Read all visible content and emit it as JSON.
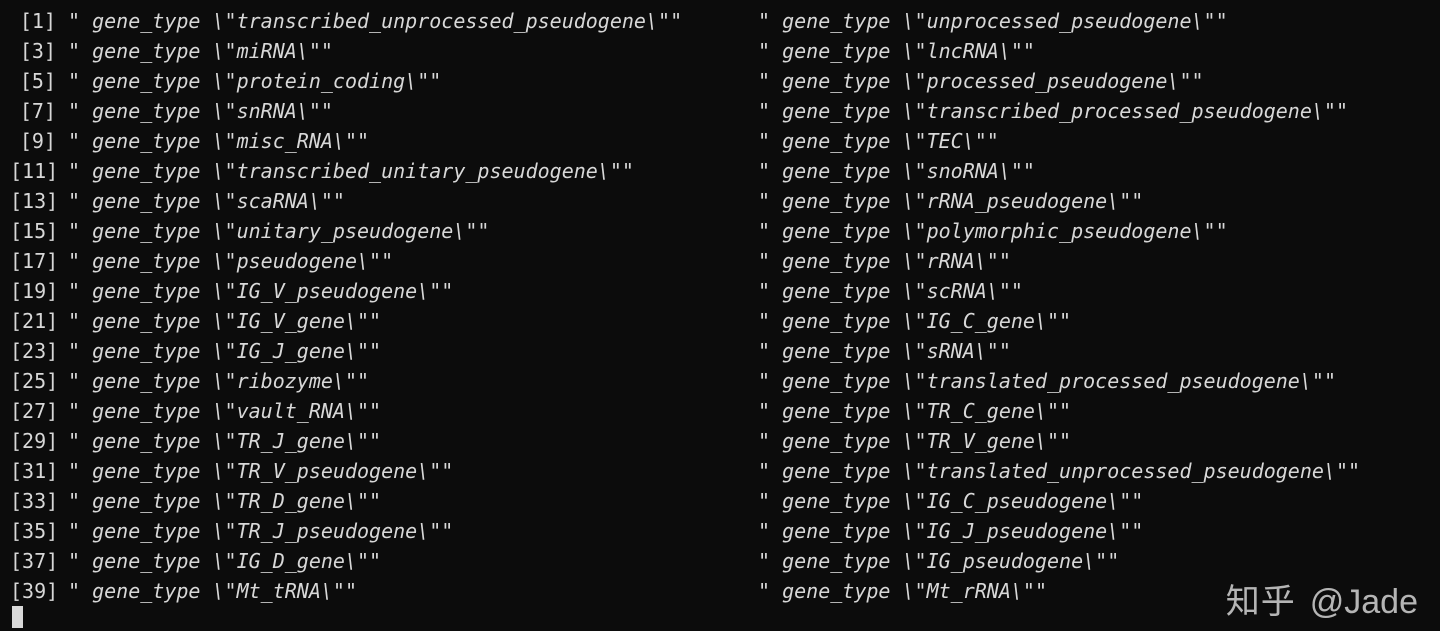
{
  "prefix": "gene_type",
  "watermark": {
    "zh": "知乎",
    "at": "@Jade"
  },
  "rows": [
    {
      "idx": "[1]",
      "left": "transcribed_unprocessed_pseudogene",
      "right": "unprocessed_pseudogene"
    },
    {
      "idx": "[3]",
      "left": "miRNA",
      "right": "lncRNA"
    },
    {
      "idx": "[5]",
      "left": "protein_coding",
      "right": "processed_pseudogene"
    },
    {
      "idx": "[7]",
      "left": "snRNA",
      "right": "transcribed_processed_pseudogene"
    },
    {
      "idx": "[9]",
      "left": "misc_RNA",
      "right": "TEC"
    },
    {
      "idx": "[11]",
      "left": "transcribed_unitary_pseudogene",
      "right": "snoRNA"
    },
    {
      "idx": "[13]",
      "left": "scaRNA",
      "right": "rRNA_pseudogene"
    },
    {
      "idx": "[15]",
      "left": "unitary_pseudogene",
      "right": "polymorphic_pseudogene"
    },
    {
      "idx": "[17]",
      "left": "pseudogene",
      "right": "rRNA"
    },
    {
      "idx": "[19]",
      "left": "IG_V_pseudogene",
      "right": "scRNA"
    },
    {
      "idx": "[21]",
      "left": "IG_V_gene",
      "right": "IG_C_gene"
    },
    {
      "idx": "[23]",
      "left": "IG_J_gene",
      "right": "sRNA"
    },
    {
      "idx": "[25]",
      "left": "ribozyme",
      "right": "translated_processed_pseudogene"
    },
    {
      "idx": "[27]",
      "left": "vault_RNA",
      "right": "TR_C_gene"
    },
    {
      "idx": "[29]",
      "left": "TR_J_gene",
      "right": "TR_V_gene"
    },
    {
      "idx": "[31]",
      "left": "TR_V_pseudogene",
      "right": "translated_unprocessed_pseudogene"
    },
    {
      "idx": "[33]",
      "left": "TR_D_gene",
      "right": "IG_C_pseudogene"
    },
    {
      "idx": "[35]",
      "left": "TR_J_pseudogene",
      "right": "IG_J_pseudogene"
    },
    {
      "idx": "[37]",
      "left": "IG_D_gene",
      "right": "IG_pseudogene"
    },
    {
      "idx": "[39]",
      "left": "Mt_tRNA",
      "right": "Mt_rRNA"
    }
  ]
}
